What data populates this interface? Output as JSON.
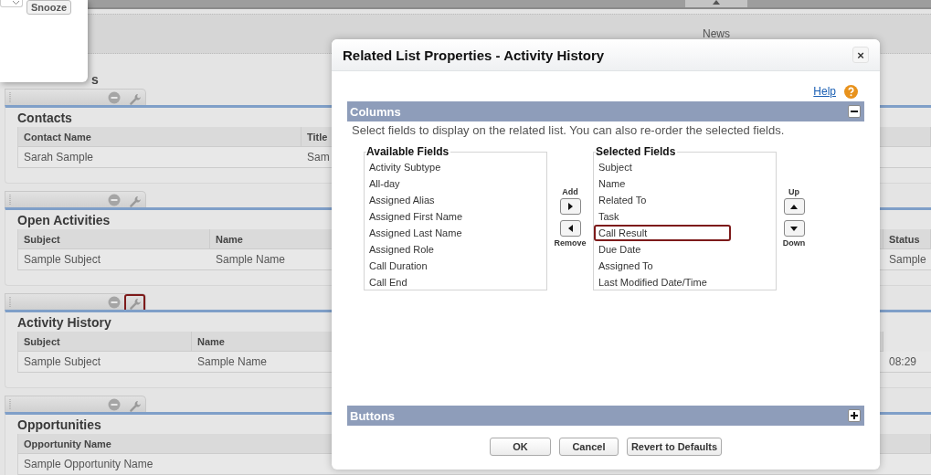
{
  "snooze_popup": {
    "button": "Snooze"
  },
  "top_bar": {
    "tab_label": "News"
  },
  "section_heading": "s",
  "sections": [
    {
      "title": "Contacts",
      "wrench_highlighted": false,
      "columns": [
        {
          "label": "Contact Name"
        },
        {
          "label": "Title"
        }
      ],
      "rows": [
        [
          {
            "text": "Sarah Sample"
          },
          {
            "text": "Sam"
          }
        ]
      ]
    },
    {
      "title": "Open Activities",
      "wrench_highlighted": false,
      "columns": [
        {
          "label": "Subject"
        },
        {
          "label": "Name"
        },
        {
          "label": "Status"
        }
      ],
      "rows": [
        [
          {
            "text": "Sample Subject"
          },
          {
            "text": "Sample Name"
          },
          {
            "text": "Sample"
          }
        ]
      ]
    },
    {
      "title": "Activity History",
      "wrench_highlighted": true,
      "columns": [
        {
          "label": "Subject"
        },
        {
          "label": "Name"
        }
      ],
      "rows": [
        [
          {
            "text": "Sample Subject"
          },
          {
            "text": "Sample Name"
          },
          {
            "text": "08:29"
          }
        ]
      ]
    },
    {
      "title": "Opportunities",
      "wrench_highlighted": false,
      "columns": [
        {
          "label": "Opportunity Name"
        }
      ],
      "rows": [
        [
          {
            "text": "Sample Opportunity Name"
          }
        ]
      ]
    }
  ],
  "dialog": {
    "title": "Related List Properties - Activity History",
    "close": "×",
    "help": "Help",
    "columns_section": {
      "title": "Columns",
      "expanded": true,
      "description": "Select fields to display on the related list. You can also re-order the selected fields.",
      "available": {
        "legend": "Available Fields",
        "items": [
          {
            "label": "Activity Subtype",
            "highlighted": false
          },
          {
            "label": "All-day",
            "highlighted": false
          },
          {
            "label": "Assigned Alias",
            "highlighted": false
          },
          {
            "label": "Assigned First Name",
            "highlighted": false
          },
          {
            "label": "Assigned Last Name",
            "highlighted": false
          },
          {
            "label": "Assigned Role",
            "highlighted": false
          },
          {
            "label": "Call Duration",
            "highlighted": false
          },
          {
            "label": "Call End",
            "highlighted": false
          }
        ]
      },
      "add": "Add",
      "remove": "Remove",
      "selected": {
        "legend": "Selected Fields",
        "items": [
          {
            "label": "Subject",
            "highlighted": false
          },
          {
            "label": "Name",
            "highlighted": false
          },
          {
            "label": "Related To",
            "highlighted": false
          },
          {
            "label": "Task",
            "highlighted": false
          },
          {
            "label": "Call Result",
            "highlighted": true
          },
          {
            "label": "Due Date",
            "highlighted": false
          },
          {
            "label": "Assigned To",
            "highlighted": false
          },
          {
            "label": "Last Modified Date/Time",
            "highlighted": false
          }
        ]
      },
      "up": "Up",
      "down": "Down"
    },
    "buttons_section": {
      "title": "Buttons",
      "expanded": false
    },
    "actions": [
      "OK",
      "Cancel",
      "Revert to Defaults"
    ]
  }
}
